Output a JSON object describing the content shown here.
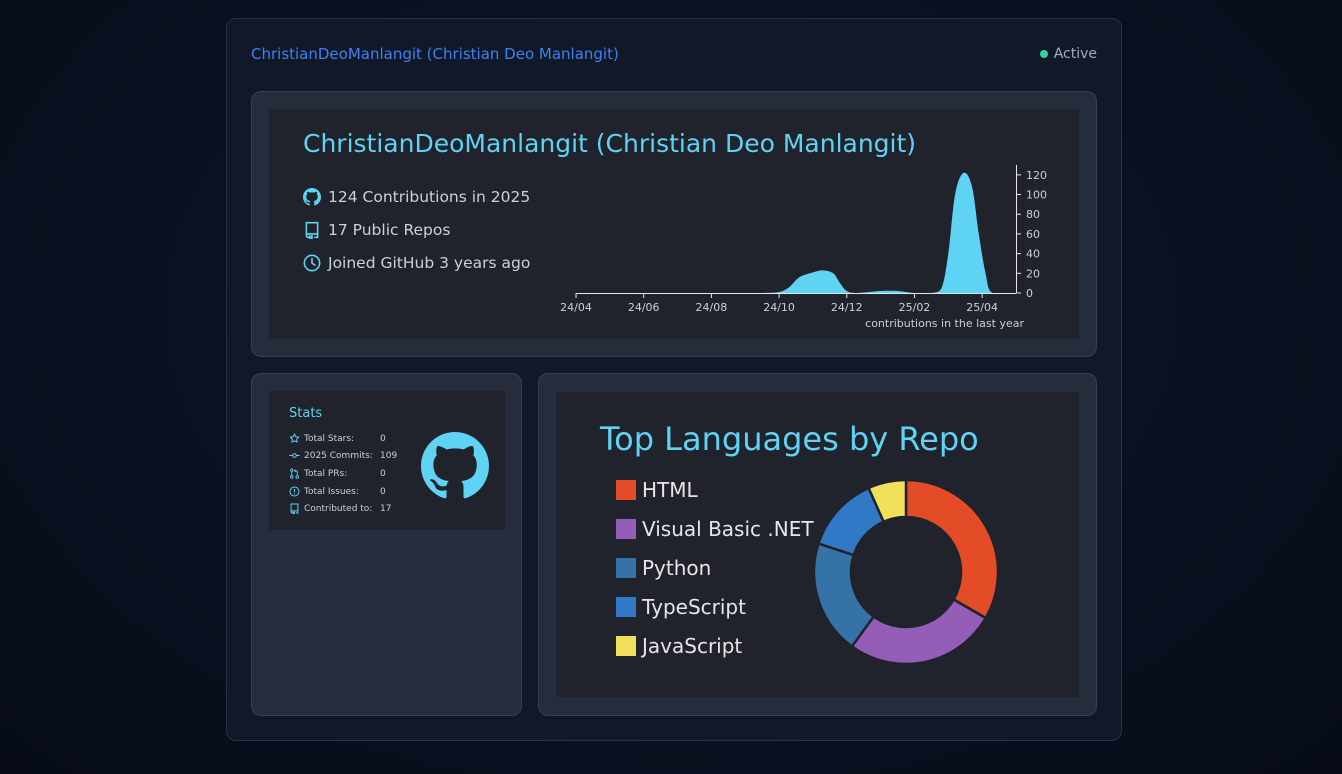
{
  "window": {
    "title": "ChristianDeoManlangit (Christian Deo Manlangit)",
    "status": "Active"
  },
  "profile": {
    "name": "ChristianDeoManlangit (Christian Deo Manlangit)",
    "contributions": "124 Contributions in 2025",
    "repos": "17 Public Repos",
    "joined": "Joined GitHub 3 years ago"
  },
  "stats": {
    "title": "Stats",
    "rows": [
      {
        "icon": "star-icon",
        "label": "Total Stars:",
        "value": "0"
      },
      {
        "icon": "commit-icon",
        "label": "2025 Commits:",
        "value": "109"
      },
      {
        "icon": "pull-request-icon",
        "label": "Total PRs:",
        "value": "0"
      },
      {
        "icon": "issue-icon",
        "label": "Total Issues:",
        "value": "0"
      },
      {
        "icon": "repo-icon",
        "label": "Contributed to:",
        "value": "17"
      }
    ]
  },
  "colors": {
    "accent": "#5fd3f3",
    "title_blue": "#3b82f6",
    "status_green": "#34d399"
  },
  "chart_data": [
    {
      "type": "area",
      "xlabel": "contributions in the last year",
      "ylabel": "",
      "x_ticks": [
        "24/04",
        "24/06",
        "24/08",
        "24/10",
        "24/12",
        "25/02",
        "25/04"
      ],
      "y_ticks": [
        0,
        20,
        40,
        60,
        80,
        100,
        120
      ],
      "ylim": [
        0,
        130
      ],
      "grid": false,
      "x_month_range": [
        0,
        13
      ],
      "points": [
        [
          0,
          0
        ],
        [
          1,
          0
        ],
        [
          2,
          0
        ],
        [
          3,
          0
        ],
        [
          4,
          0
        ],
        [
          5,
          0
        ],
        [
          5.5,
          0
        ],
        [
          6,
          1
        ],
        [
          6.3,
          6
        ],
        [
          6.6,
          16
        ],
        [
          7,
          21
        ],
        [
          7.3,
          23
        ],
        [
          7.6,
          20
        ],
        [
          7.8,
          10
        ],
        [
          8,
          2
        ],
        [
          8.3,
          0
        ],
        [
          9,
          2
        ],
        [
          9.5,
          2
        ],
        [
          10,
          0
        ],
        [
          10.5,
          0
        ],
        [
          10.8,
          5
        ],
        [
          11,
          40
        ],
        [
          11.2,
          100
        ],
        [
          11.45,
          122
        ],
        [
          11.7,
          108
        ],
        [
          11.9,
          60
        ],
        [
          12.1,
          20
        ],
        [
          12.3,
          0
        ],
        [
          13,
          0
        ]
      ]
    },
    {
      "type": "pie",
      "title": "Top Languages by Repo",
      "labels": [
        "HTML",
        "Visual Basic .NET",
        "Python",
        "TypeScript",
        "JavaScript"
      ],
      "colors": [
        "#e34c26",
        "#945db7",
        "#3572a5",
        "#3178c6",
        "#f1e05a"
      ],
      "values": [
        5,
        4,
        3,
        2,
        1
      ]
    }
  ]
}
